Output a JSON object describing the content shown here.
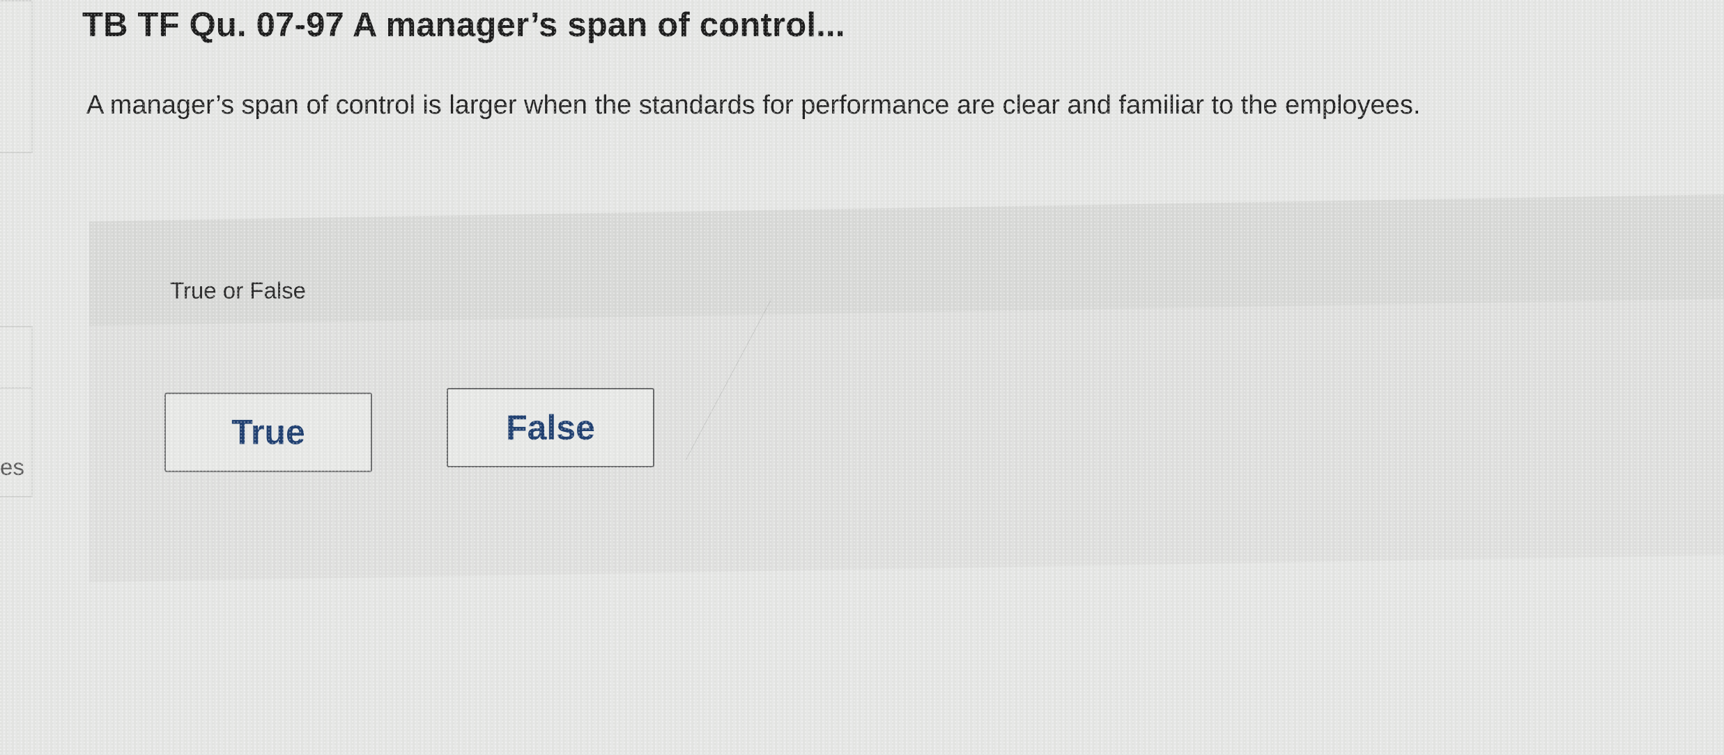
{
  "sidebar": {
    "partial_label": "es"
  },
  "question": {
    "title": "TB TF Qu. 07-97 A manager’s span of control...",
    "text": "A manager’s span of control is larger when the standards for performance are clear and familiar to the employees."
  },
  "answer_area": {
    "type_label": "True or False",
    "options": [
      {
        "label": "True"
      },
      {
        "label": "False"
      }
    ]
  },
  "colors": {
    "background": "#e6e7e5",
    "panel": "#dfe0de",
    "button_text": "#1f3f70",
    "button_border": "#6a6b6c"
  }
}
